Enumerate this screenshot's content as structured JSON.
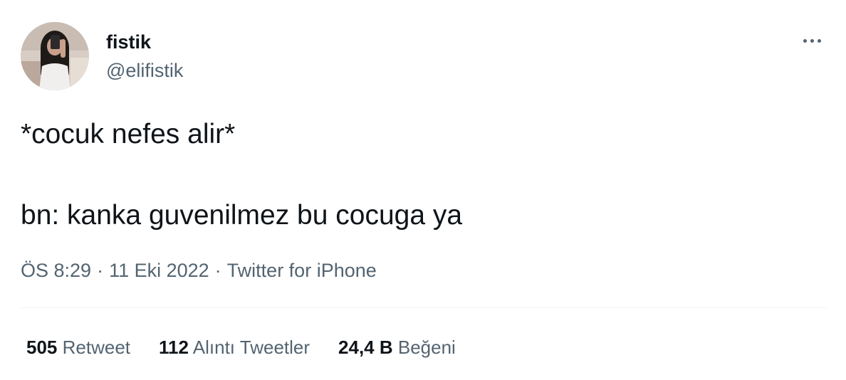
{
  "author": {
    "display_name": "fistik",
    "handle": "@elifistik"
  },
  "tweet": {
    "line_1": "*cocuk nefes alir*",
    "line_2": "bn: kanka guvenilmez bu cocuga ya"
  },
  "meta": {
    "time": "ÖS 8:29",
    "separator_1": "·",
    "date": "11 Eki 2022",
    "separator_2": "·",
    "source": "Twitter for iPhone"
  },
  "stats": {
    "retweets": {
      "count": "505",
      "label": "Retweet"
    },
    "quotes": {
      "count": "112",
      "label": "Alıntı Tweetler"
    },
    "likes": {
      "count": "24,4 B",
      "label": "Beğeni"
    }
  },
  "colors": {
    "text_primary": "#0f1419",
    "text_secondary": "#536471",
    "divider": "#eff3f4",
    "background": "#ffffff"
  },
  "icons": {
    "more": "more-horizontal-icon"
  }
}
